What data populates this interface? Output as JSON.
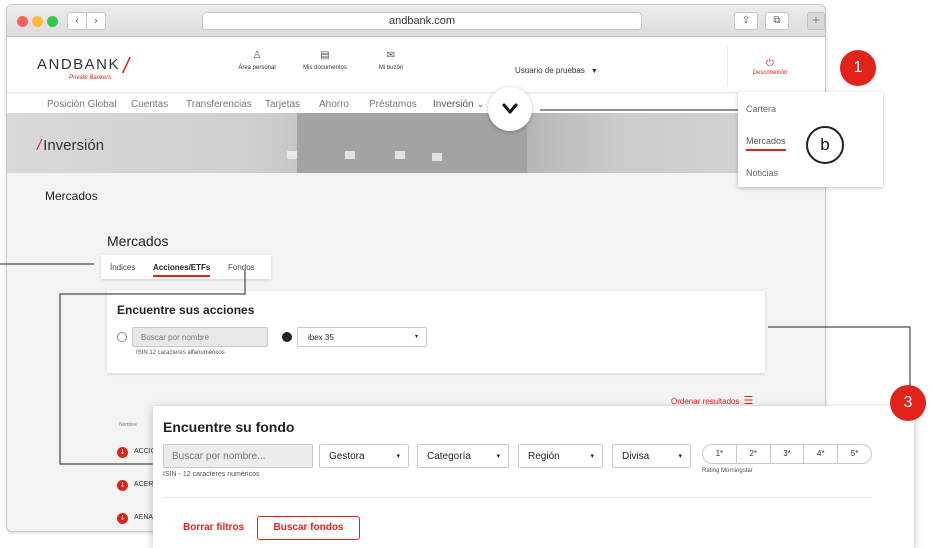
{
  "browser": {
    "url": "andbank.com",
    "back_glyph": "‹",
    "forward_glyph": "›",
    "share_glyph": "⇪",
    "tabs_glyph": "⧉",
    "new_tab_glyph": "+"
  },
  "header": {
    "logo": "ANDBANK",
    "logo_slash": "/",
    "logo_sub": "Private Bankers",
    "icons": [
      {
        "label": "Área personal",
        "icon": "user-icon",
        "glyph": "♙"
      },
      {
        "label": "Mis documentos",
        "icon": "document-icon",
        "glyph": "▤"
      },
      {
        "label": "Mi buzón",
        "icon": "mail-icon",
        "glyph": "✉"
      }
    ],
    "user": "Usuario de pruebas",
    "user_caret": "▼",
    "logout": "Desconexión",
    "logout_glyph": "⏻"
  },
  "nav": {
    "items": [
      "Posición Global",
      "Cuentas",
      "Transferencias",
      "Tarjetas",
      "Ahorro",
      "Préstamos",
      "Inversión"
    ],
    "active": "Inversión",
    "caret": "⌄"
  },
  "hero": {
    "slash": "/",
    "title": "Inversión"
  },
  "page": {
    "section_title": "Mercados",
    "markets_title": "Mercados"
  },
  "tabs": [
    "Índices",
    "Acciones/ETFs",
    "Fondos"
  ],
  "search_card": {
    "title": "Encuentre sus acciones",
    "input_placeholder": "Buscar por nombre",
    "hint": "ISIN 12 caracteres alfanuméricos",
    "select_value": "ibex 35",
    "caret": "▾"
  },
  "results": {
    "order_label": "Ordenar resultados",
    "order_glyph": "☰",
    "col_name": "Nombre",
    "rows": [
      "ACCIO",
      "ACERI",
      "AENA"
    ],
    "row_glyph": "↓"
  },
  "dropdown": {
    "items": [
      "Cartera",
      "Mercados",
      "Noticias"
    ],
    "active": "Mercados"
  },
  "annotations": {
    "one": "1",
    "b": "b",
    "three": "3"
  },
  "fund_card": {
    "title": "Encuentre su fondo",
    "input_placeholder": "Buscar por nombre...",
    "hint": "ISIN - 12 caracteres numéricos",
    "selects": [
      "Gestora",
      "Categoría",
      "Región",
      "Divisa"
    ],
    "caret": "▾",
    "stars": [
      "1*",
      "2*",
      "3*",
      "4*",
      "5*"
    ],
    "rating_label": "Rating Morningstar",
    "clear_label": "Borrar filtros",
    "submit_label": "Buscar fondos"
  },
  "colors": {
    "brand_red": "#e2231a"
  }
}
